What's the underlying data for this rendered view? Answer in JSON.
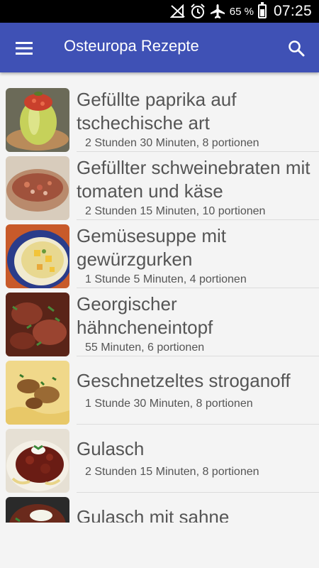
{
  "status_bar": {
    "battery_percent": "65 %",
    "battery_level": 0.65,
    "time": "07:25",
    "icons": [
      "no-signal-icon",
      "alarm-icon",
      "airplane-mode-icon",
      "battery-icon"
    ]
  },
  "app_bar": {
    "title": "Osteuropa Rezepte",
    "color": "#3f51b5",
    "menu_icon": "hamburger-menu-icon",
    "search_icon": "search-icon"
  },
  "recipes": [
    {
      "title": "Gefüllte paprika auf tschechische art",
      "meta": "2 Stunden 30 Minuten, 8 portionen"
    },
    {
      "title": "Gefüllter schweinebraten mit tomaten und käse",
      "meta": "2 Stunden 15 Minuten, 10 portionen"
    },
    {
      "title": "Gemüsesuppe mit gewürzgurken",
      "meta": "1 Stunde 5 Minuten, 4 portionen"
    },
    {
      "title": "Georgischer hähncheneintopf",
      "meta": "55 Minuten, 6 portionen"
    },
    {
      "title": "Geschnetzeltes stroganoff",
      "meta": "1 Stunde 30 Minuten, 8 portionen"
    },
    {
      "title": "Gulasch",
      "meta": "2 Stunden 15 Minuten, 8 portionen"
    },
    {
      "title": "Gulasch mit sahne",
      "meta": ""
    }
  ]
}
